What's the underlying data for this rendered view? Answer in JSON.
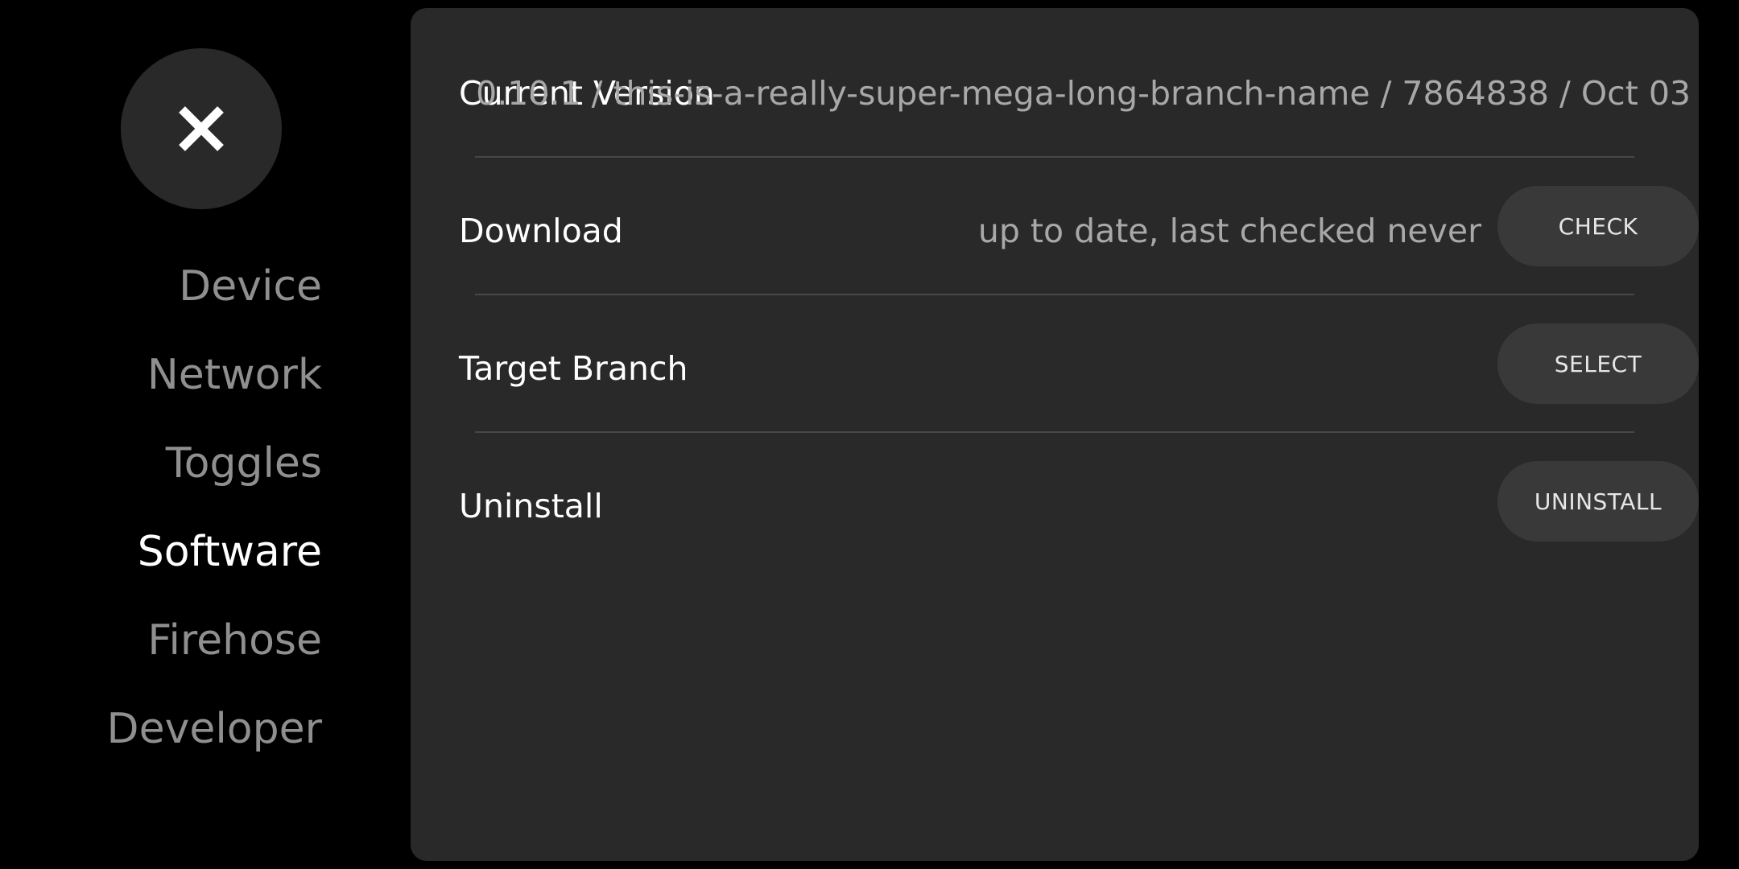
{
  "sidebar": {
    "close_icon": "close-icon",
    "items": [
      {
        "label": "Device"
      },
      {
        "label": "Network"
      },
      {
        "label": "Toggles"
      },
      {
        "label": "Software"
      },
      {
        "label": "Firehose"
      },
      {
        "label": "Developer"
      }
    ],
    "active": "Software"
  },
  "panel": {
    "rows": [
      {
        "label": "Current Version",
        "value": "0.10.1 / this-is-a-really-super-mega-long-branch-name / 7864838 / Oct 03"
      },
      {
        "label": "Download",
        "value": "up to date, last checked never",
        "button": "CHECK"
      },
      {
        "label": "Target Branch",
        "button": "SELECT"
      },
      {
        "label": "Uninstall",
        "button": "UNINSTALL"
      }
    ]
  },
  "colors": {
    "background": "#000000",
    "panel": "#292929",
    "button": "#393939",
    "nav_inactive": "#8f8f8f",
    "nav_active": "#ffffff",
    "value_text": "#a8a8a8",
    "divider": "#474747"
  }
}
